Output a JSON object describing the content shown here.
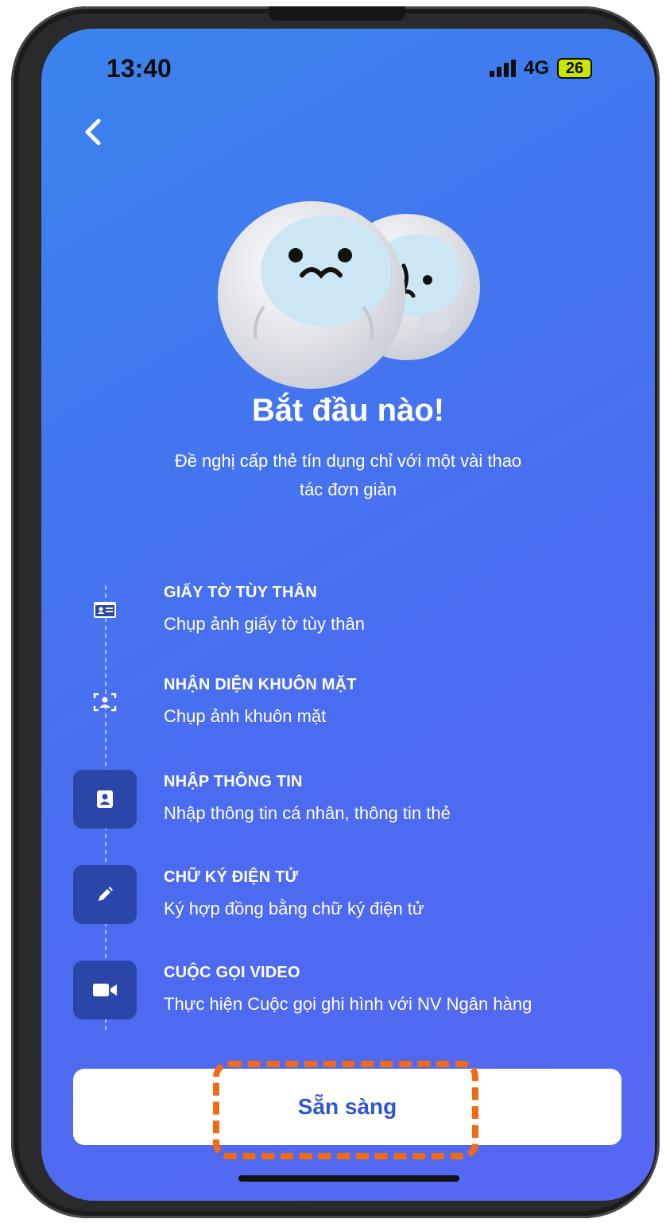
{
  "status_bar": {
    "time": "13:40",
    "network": "4G",
    "battery": "26"
  },
  "hero": {
    "title": "Bắt đầu nào!",
    "subtitle": "Đề nghị cấp thẻ tín dụng chỉ với một vài thao tác đơn giản"
  },
  "steps": [
    {
      "title": "GIẤY TỜ TÙY THÂN",
      "desc": "Chụp ảnh giấy tờ tùy thân",
      "icon": "id-card-icon"
    },
    {
      "title": "NHẬN DIỆN KHUÔN MẶT",
      "desc": "Chụp ảnh khuôn mặt",
      "icon": "face-scan-icon"
    },
    {
      "title": "NHẬP THÔNG TIN",
      "desc": "Nhập thông tin cá nhân, thông tin thẻ",
      "icon": "contact-icon"
    },
    {
      "title": "CHỮ KÝ ĐIỆN TỬ",
      "desc": "Ký hợp đồng bằng chữ ký điện tử",
      "icon": "pencil-icon"
    },
    {
      "title": "CUỘC GỌI VIDEO",
      "desc": "Thực hiện Cuộc gọi ghi hình với NV Ngân hàng",
      "icon": "video-camera-icon"
    }
  ],
  "cta": {
    "label": "Sẵn sàng"
  },
  "colors": {
    "accent": "#2f55d4",
    "highlight": "#f26a12",
    "background_start": "#3a84ee",
    "background_end": "#5667f2"
  }
}
